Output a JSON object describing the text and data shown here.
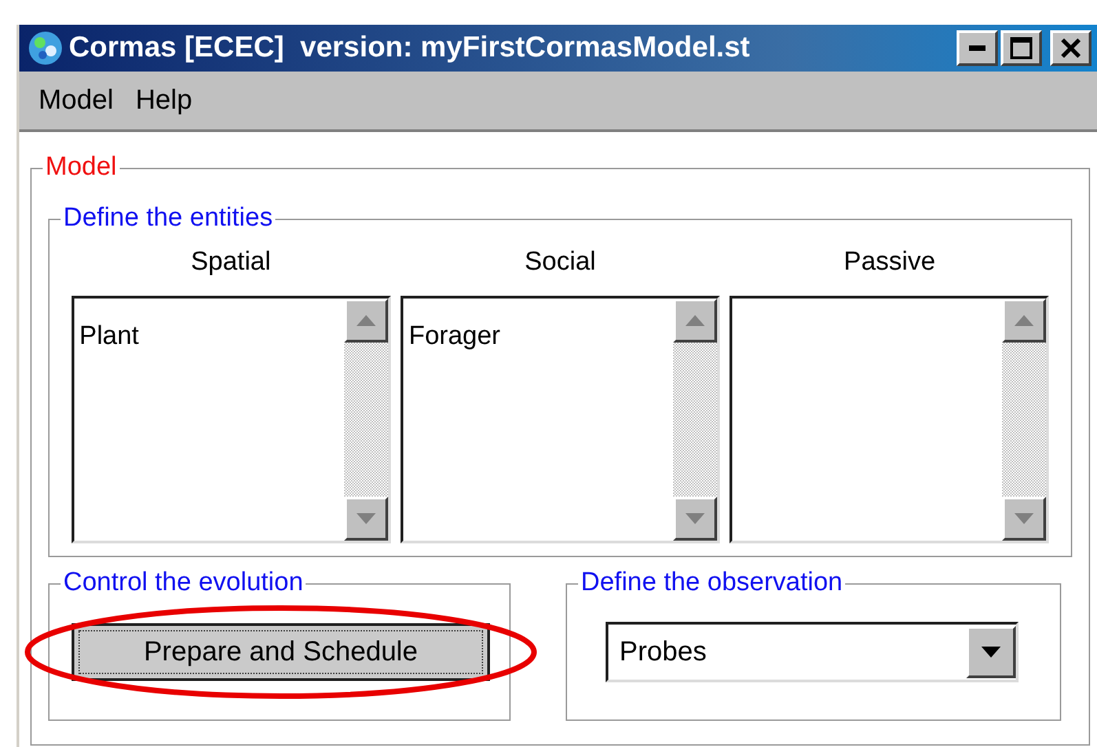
{
  "window": {
    "title": "Cormas [ECEC]  version: myFirstCormasModel.st"
  },
  "menu": [
    "Model",
    "Help"
  ],
  "model_group": {
    "title": "Model",
    "entities": {
      "title": "Define the entities",
      "lists": [
        {
          "heading": "Spatial",
          "items": [
            "Plant"
          ]
        },
        {
          "heading": "Social",
          "items": [
            "Forager"
          ]
        },
        {
          "heading": "Passive"
        }
      ]
    },
    "control": {
      "title": "Control the evolution",
      "button": "Prepare and Schedule",
      "highlighted": true
    },
    "observation": {
      "title": "Define the observation",
      "value": "Probes"
    }
  }
}
